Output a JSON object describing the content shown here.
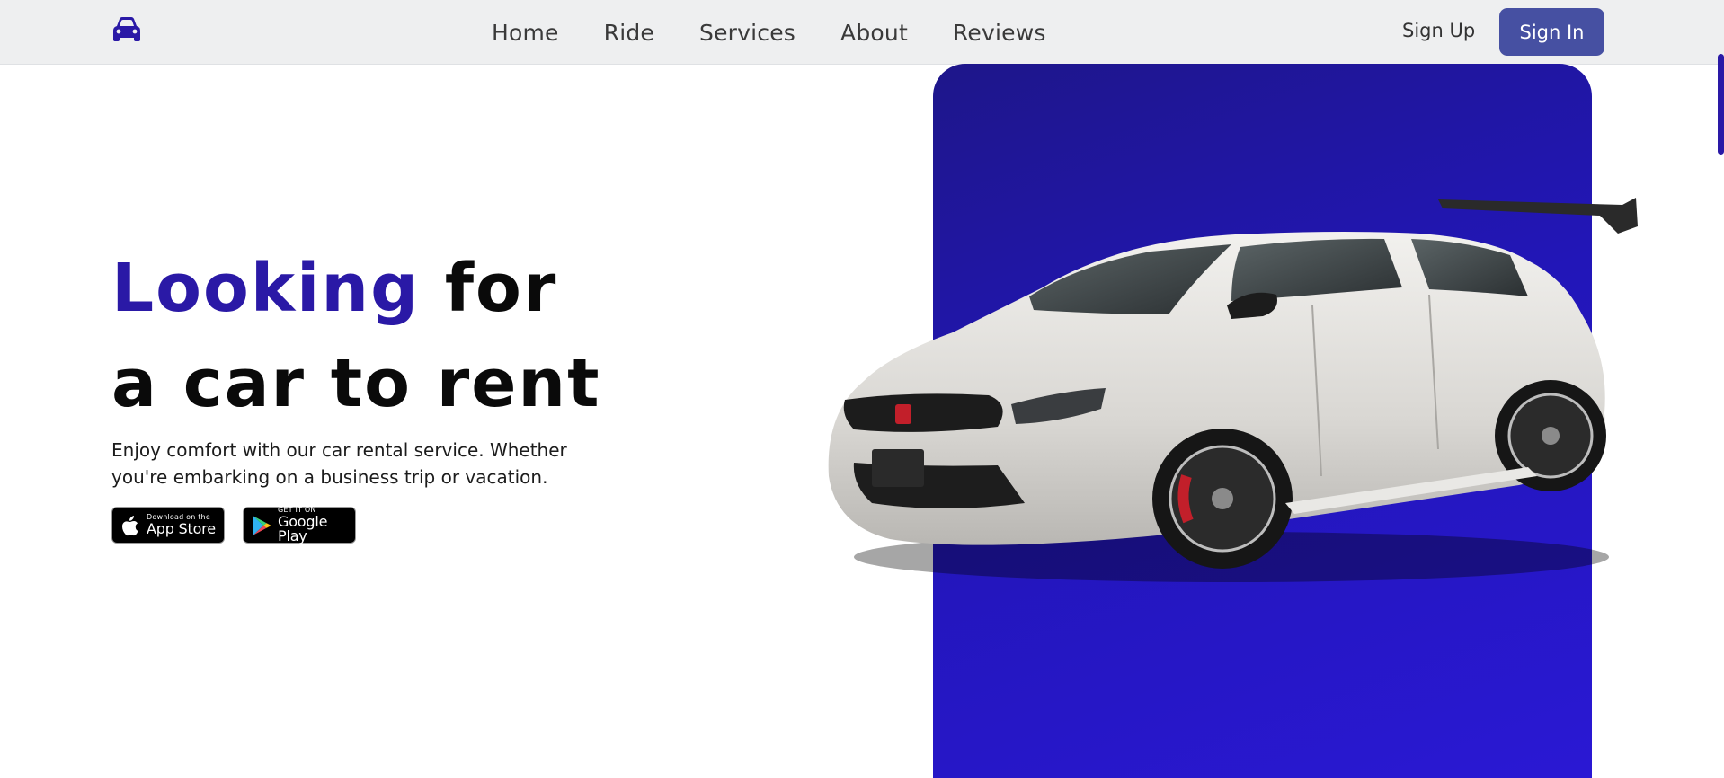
{
  "header": {
    "logo_icon": "car-icon",
    "nav": [
      "Home",
      "Ride",
      "Services",
      "About",
      "Reviews"
    ],
    "sign_up_label": "Sign Up",
    "sign_in_label": "Sign In"
  },
  "hero": {
    "title_accent": "Looking",
    "title_line1_rest": "for",
    "title_line2": "a car to rent",
    "description": "Enjoy comfort with our car rental service. Whether you're embarking on a business trip or vacation.",
    "stores": {
      "appstore_small": "Download on the",
      "appstore_big": "App Store",
      "gplay_small": "GET IT ON",
      "gplay_big": "Google Play"
    }
  },
  "colors": {
    "accent": "#2a19a6",
    "button": "#4650a2",
    "panel": "#2216b8",
    "header_bg": "#eeeff0"
  }
}
